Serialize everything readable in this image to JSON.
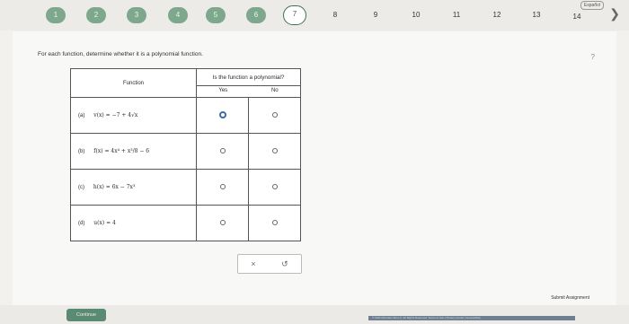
{
  "nav": {
    "questions": [
      {
        "label": "1",
        "state": "done"
      },
      {
        "label": "2",
        "state": "done"
      },
      {
        "label": "3",
        "state": "done"
      },
      {
        "label": "4",
        "state": "done"
      },
      {
        "label": "5",
        "state": "done"
      },
      {
        "label": "6",
        "state": "done"
      },
      {
        "label": "7",
        "state": "current"
      },
      {
        "label": "8",
        "state": "plain"
      },
      {
        "label": "9",
        "state": "plain"
      },
      {
        "label": "10",
        "state": "plain"
      },
      {
        "label": "11",
        "state": "plain"
      },
      {
        "label": "12",
        "state": "plain"
      },
      {
        "label": "13",
        "state": "plain"
      },
      {
        "label": "14",
        "state": "plain"
      }
    ],
    "language_label": "Español"
  },
  "question": {
    "instruction": "For each function, determine whether it is a polynomial function.",
    "table": {
      "function_header": "Function",
      "polynomial_header": "Is the function a polynomial?",
      "yes_header": "Yes",
      "no_header": "No",
      "rows": [
        {
          "label": "(a)",
          "expr": "v(x) = −7 + 4√x",
          "selected": "yes"
        },
        {
          "label": "(b)",
          "expr": "f(x) = 4x⁴ + x³/8 − 6",
          "selected": null
        },
        {
          "label": "(c)",
          "expr": "h(x) = 6x − 7x³",
          "selected": null
        },
        {
          "label": "(d)",
          "expr": "u(x) = 4",
          "selected": null
        }
      ]
    }
  },
  "actions": {
    "clear_symbol": "×",
    "undo_symbol": "↺",
    "submit_label": "Submit Assignment",
    "continue_label": "Continue"
  },
  "footer": {
    "text": "© 2022 McGraw Hill LLC. All Rights Reserved. Terms of Use | Privacy Center | Accessibility"
  }
}
